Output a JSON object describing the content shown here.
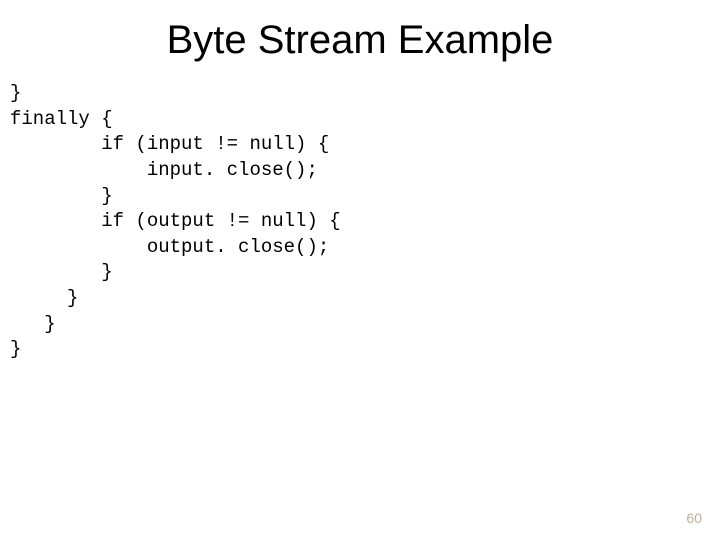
{
  "title": "Byte Stream Example",
  "code_lines": [
    "}",
    "finally {",
    "        if (input != null) {",
    "            input. close();",
    "        }",
    "        if (output != null) {",
    "            output. close();",
    "        }",
    "     }",
    "   }",
    "}"
  ],
  "page_number": "60"
}
